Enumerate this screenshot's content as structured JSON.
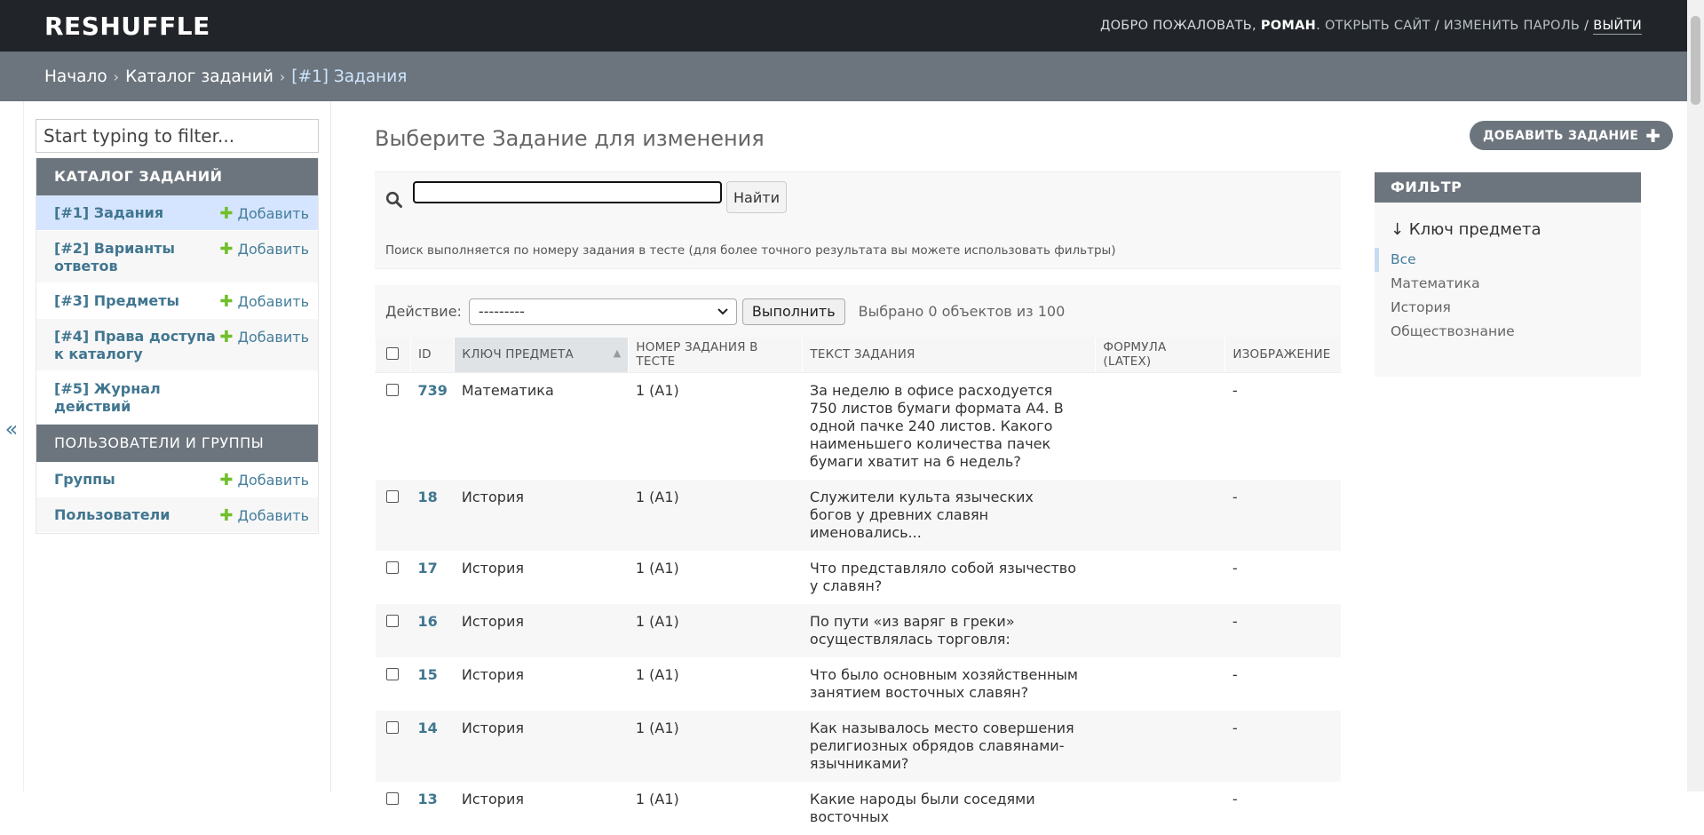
{
  "header": {
    "brand": "RESHUFFLE",
    "welcome": "Добро пожаловать,",
    "username": "Роман",
    "view_site": "Открыть сайт",
    "change_password": "Изменить пароль",
    "logout": "Выйти",
    "separator": "/"
  },
  "breadcrumbs": {
    "home": "Начало",
    "catalog": "Каталог заданий",
    "current": "[#1] Задания",
    "sep": "›"
  },
  "sidebar": {
    "toggle": "«",
    "filter_placeholder": "Start typing to filter...",
    "modules": [
      {
        "caption": "Каталог заданий",
        "items": [
          {
            "label": "[#1] Задания",
            "add": "Добавить"
          },
          {
            "label": "[#2] Варианты ответов",
            "add": "Добавить"
          },
          {
            "label": "[#3] Предметы",
            "add": "Добавить"
          },
          {
            "label": "[#4] Права доступа к каталогу",
            "add": "Добавить"
          },
          {
            "label": "[#5] Журнал действий"
          }
        ]
      },
      {
        "caption": "Пользователи и группы",
        "items": [
          {
            "label": "Группы",
            "add": "Добавить"
          },
          {
            "label": "Пользователи",
            "add": "Добавить"
          }
        ]
      }
    ]
  },
  "content": {
    "title": "Выберите Задание для изменения",
    "add_button": "Добавить задание",
    "search_button": "Найти",
    "search_help": "Поиск выполняется по номеру задания в тесте (для более точного результата вы можете использовать фильтры)",
    "action_label": "Действие:",
    "action_selected": "---------",
    "run_button": "Выполнить",
    "counter": "Выбрано 0 объектов из 100",
    "columns": [
      "ID",
      "Ключ предмета",
      "Номер задания в тесте",
      "Текст задания",
      "Формула (LaTeX)",
      "Изображение"
    ],
    "rows": [
      {
        "id": "739",
        "subject": "Математика",
        "number": "1 (A1)",
        "text": "За неделю в офисе расходуется 750 листов бумаги формата А4. В одной пачке 240 листов. Какого наименьшего количества пачек бумаги хватит на 6 недель?",
        "formula": "",
        "image": "-"
      },
      {
        "id": "18",
        "subject": "История",
        "number": "1 (A1)",
        "text": "Служители культа языческих богов у древних славян именовались...",
        "formula": "",
        "image": "-"
      },
      {
        "id": "17",
        "subject": "История",
        "number": "1 (A1)",
        "text": "Что представляло собой язычество у славян?",
        "formula": "",
        "image": "-"
      },
      {
        "id": "16",
        "subject": "История",
        "number": "1 (A1)",
        "text": "По пути «из варяг в греки» осуществлялась торговля:",
        "formula": "",
        "image": "-"
      },
      {
        "id": "15",
        "subject": "История",
        "number": "1 (A1)",
        "text": "Что было основным хозяйственным занятием восточных славян?",
        "formula": "",
        "image": "-"
      },
      {
        "id": "14",
        "subject": "История",
        "number": "1 (A1)",
        "text": "Как называлось место совершения религиозных обрядов славянами-язычниками?",
        "formula": "",
        "image": "-"
      },
      {
        "id": "13",
        "subject": "История",
        "number": "1 (A1)",
        "text": "Какие народы были соседями восточных",
        "formula": "",
        "image": "-"
      }
    ]
  },
  "filter": {
    "caption": "Фильтр",
    "title": "↓ Ключ предмета",
    "options": [
      "Все",
      "Математика",
      "История",
      "Обществознание"
    ],
    "selected": "Все"
  },
  "colors": {
    "header_bg": "#212529",
    "breadcrumbs_bg": "#6c757d",
    "link": "#417690",
    "add_plus": "#70bf2b",
    "active_row": "#d6e5ff"
  }
}
